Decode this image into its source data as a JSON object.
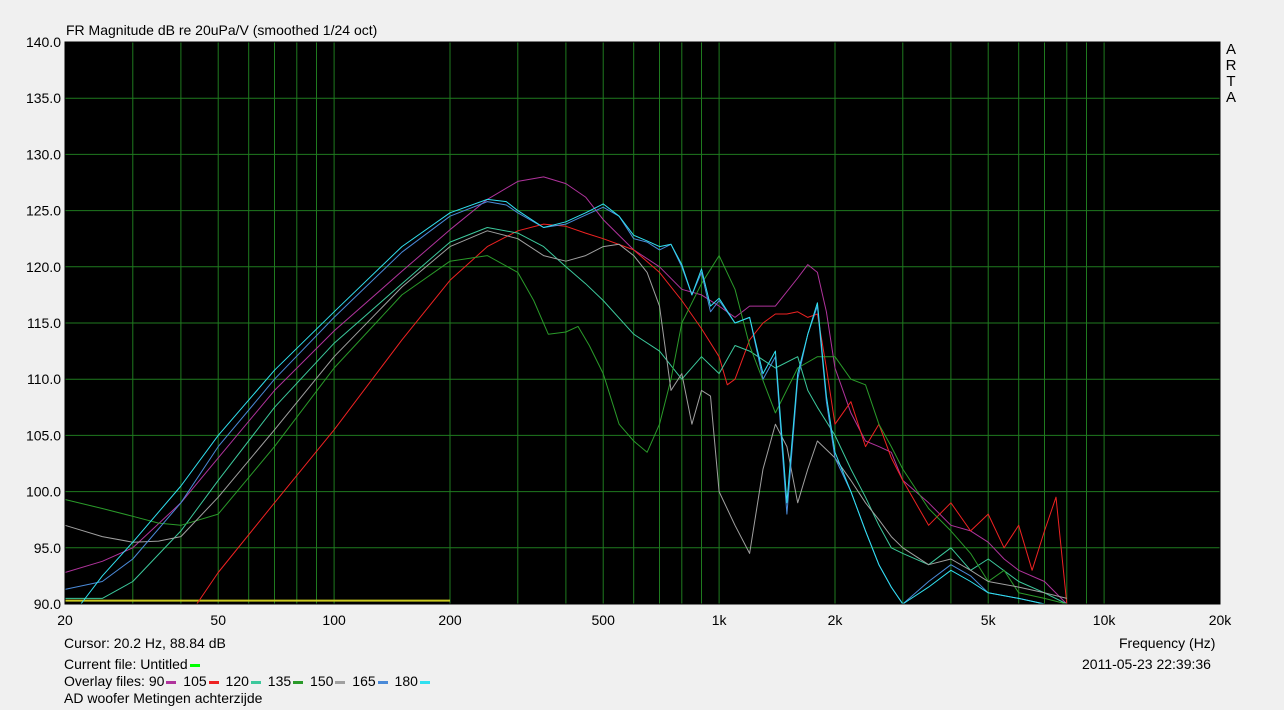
{
  "app": {
    "title": "FR Magnitude dB re 20uPa/V (smoothed 1/24 oct)",
    "watermark": [
      "A",
      "R",
      "T",
      "A"
    ]
  },
  "status": {
    "cursor": "Cursor: 20.2 Hz, 88.84 dB",
    "current_file_label": "Current file: Untitled",
    "current_file_color": "#00ff00",
    "overlay_label": "Overlay files:",
    "overlays": [
      {
        "label": "90",
        "color": "#b0339c"
      },
      {
        "label": "105",
        "color": "#ee2222"
      },
      {
        "label": "120",
        "color": "#3cc89c"
      },
      {
        "label": "135",
        "color": "#2a9a2a"
      },
      {
        "label": "150",
        "color": "#a0a0a0"
      },
      {
        "label": "165",
        "color": "#4a8ad8"
      },
      {
        "label": "180",
        "color": "#30e0f0"
      }
    ],
    "file_name": "AD woofer Metingen achterzijde",
    "x_axis_title": "Frequency (Hz)",
    "timestamp": "2011-05-23  22:39:36"
  },
  "chart_data": {
    "type": "line",
    "title": "FR Magnitude dB re 20uPa/V (smoothed 1/24 oct)",
    "xlabel": "Frequency (Hz)",
    "ylabel": "",
    "x_scale": "log",
    "xlim": [
      20,
      20000
    ],
    "ylim": [
      90,
      140
    ],
    "grid": true,
    "background": "#000000",
    "grid_color": "#1f7a1f",
    "x_ticks": [
      {
        "value": 20,
        "label": "20"
      },
      {
        "value": 50,
        "label": "50"
      },
      {
        "value": 100,
        "label": "100"
      },
      {
        "value": 200,
        "label": "200"
      },
      {
        "value": 500,
        "label": "500"
      },
      {
        "value": 1000,
        "label": "1k"
      },
      {
        "value": 2000,
        "label": "2k"
      },
      {
        "value": 5000,
        "label": "5k"
      },
      {
        "value": 10000,
        "label": "10k"
      },
      {
        "value": 20000,
        "label": "20k"
      }
    ],
    "y_ticks": [
      {
        "value": 90,
        "label": "90.0"
      },
      {
        "value": 95,
        "label": "95.0"
      },
      {
        "value": 100,
        "label": "100.0"
      },
      {
        "value": 105,
        "label": "105.0"
      },
      {
        "value": 110,
        "label": "110.0"
      },
      {
        "value": 115,
        "label": "115.0"
      },
      {
        "value": 120,
        "label": "120.0"
      },
      {
        "value": 125,
        "label": "125.0"
      },
      {
        "value": 130,
        "label": "130.0"
      },
      {
        "value": 135,
        "label": "135.0"
      },
      {
        "value": 140,
        "label": "140.0"
      }
    ],
    "series": [
      {
        "name": "Untitled",
        "color": "#c8c820",
        "x": [
          20,
          200
        ],
        "y": [
          90.3,
          90.3
        ]
      },
      {
        "name": "90",
        "color": "#b0339c",
        "x": [
          20,
          25,
          30,
          40,
          50,
          70,
          100,
          150,
          200,
          250,
          300,
          350,
          400,
          450,
          500,
          600,
          700,
          800,
          900,
          1000,
          1100,
          1200,
          1400,
          1600,
          1700,
          1800,
          1900,
          2000,
          2200,
          2400,
          2600,
          2800,
          3000,
          3500,
          4000,
          4500,
          5000,
          5500,
          6000,
          7000,
          8000
        ],
        "y": [
          92.8,
          93.8,
          95.0,
          99.0,
          103.0,
          109.0,
          114.3,
          119.6,
          123.3,
          126.0,
          127.6,
          128.0,
          127.4,
          126.2,
          124.2,
          121.5,
          120.0,
          118.0,
          117.5,
          116.5,
          115.5,
          116.5,
          116.5,
          119.0,
          120.2,
          119.5,
          116.0,
          111.0,
          107.0,
          104.5,
          104.0,
          103.5,
          101.0,
          99.0,
          97.0,
          96.5,
          95.5,
          94.0,
          93.0,
          92.0,
          90.0
        ]
      },
      {
        "name": "105",
        "color": "#ee2222",
        "x": [
          44,
          50,
          70,
          100,
          150,
          200,
          250,
          300,
          350,
          400,
          450,
          500,
          600,
          700,
          800,
          900,
          1000,
          1050,
          1100,
          1200,
          1300,
          1400,
          1500,
          1600,
          1700,
          1800,
          1900,
          2000,
          2200,
          2400,
          2600,
          2800,
          3000,
          3500,
          4000,
          4500,
          5000,
          5500,
          6000,
          6500,
          7000,
          7500,
          8000
        ],
        "y": [
          90.0,
          92.8,
          99.0,
          105.5,
          113.5,
          118.8,
          121.8,
          123.2,
          123.8,
          123.6,
          123.0,
          122.5,
          121.5,
          119.5,
          117.0,
          114.5,
          112.0,
          109.5,
          110.0,
          113.5,
          115.0,
          115.8,
          115.8,
          116.0,
          115.5,
          115.8,
          111.0,
          106.0,
          108.0,
          104.0,
          106.0,
          103.0,
          101.0,
          97.0,
          99.0,
          96.5,
          98.0,
          95.0,
          97.0,
          93.0,
          96.5,
          99.5,
          90.0
        ]
      },
      {
        "name": "120",
        "color": "#3cc89c",
        "x": [
          20,
          25,
          30,
          40,
          50,
          70,
          100,
          150,
          200,
          250,
          300,
          350,
          400,
          450,
          500,
          600,
          700,
          800,
          900,
          1000,
          1100,
          1200,
          1400,
          1600,
          1700,
          1800,
          2000,
          2200,
          2400,
          2600,
          2800,
          3000,
          3500,
          4000,
          4500,
          5000,
          6000,
          7000,
          8000
        ],
        "y": [
          90.5,
          90.5,
          92.0,
          96.5,
          101.0,
          107.5,
          113.2,
          118.5,
          122.2,
          123.5,
          123.0,
          121.8,
          120.0,
          118.5,
          117.0,
          114.0,
          112.5,
          110.0,
          112.0,
          110.5,
          113.0,
          112.5,
          111.0,
          112.0,
          109.0,
          107.5,
          105.0,
          102.0,
          99.5,
          97.0,
          95.0,
          94.5,
          93.5,
          95.0,
          93.0,
          94.0,
          92.0,
          91.0,
          90.0
        ]
      },
      {
        "name": "135",
        "color": "#2a9a2a",
        "x": [
          20,
          25,
          30,
          35,
          40,
          50,
          70,
          100,
          150,
          200,
          250,
          300,
          330,
          360,
          400,
          430,
          460,
          500,
          550,
          600,
          650,
          700,
          750,
          800,
          900,
          1000,
          1100,
          1200,
          1400,
          1600,
          1800,
          2000,
          2200,
          2400,
          2600,
          2800,
          3000,
          3500,
          4000,
          4500,
          5000,
          5500,
          6000,
          7000,
          8000
        ],
        "y": [
          99.3,
          98.5,
          97.8,
          97.2,
          97.0,
          98.0,
          104.0,
          111.0,
          117.5,
          120.5,
          121.0,
          119.5,
          117.0,
          114.0,
          114.2,
          114.7,
          113.0,
          110.5,
          106.0,
          104.5,
          103.5,
          106.0,
          110.0,
          115.0,
          118.5,
          121.0,
          118.0,
          113.0,
          107.0,
          111.0,
          112.0,
          112.0,
          110.0,
          109.5,
          106.0,
          104.0,
          102.0,
          98.5,
          96.5,
          94.5,
          92.0,
          93.0,
          91.0,
          90.5,
          90.0
        ]
      },
      {
        "name": "150",
        "color": "#a0a0a0",
        "x": [
          20,
          25,
          30,
          35,
          40,
          50,
          70,
          100,
          150,
          200,
          250,
          300,
          350,
          400,
          450,
          500,
          550,
          600,
          650,
          700,
          750,
          800,
          850,
          900,
          950,
          1000,
          1100,
          1200,
          1300,
          1400,
          1500,
          1600,
          1700,
          1800,
          2000,
          2200,
          2400,
          2600,
          2800,
          3000,
          3500,
          4000,
          4500,
          5000,
          6000,
          7000,
          8000
        ],
        "y": [
          97.0,
          96.0,
          95.5,
          95.6,
          96.0,
          99.5,
          105.5,
          112.0,
          118.2,
          121.8,
          123.2,
          122.5,
          121.0,
          120.5,
          121.0,
          121.8,
          122.0,
          121.0,
          119.5,
          116.5,
          109.0,
          110.5,
          106.0,
          109.0,
          108.5,
          100.0,
          97.0,
          94.5,
          102.0,
          106.0,
          104.0,
          99.0,
          102.0,
          104.5,
          103.0,
          101.0,
          99.0,
          97.5,
          96.0,
          95.0,
          93.5,
          94.0,
          93.0,
          92.0,
          91.5,
          91.0,
          90.5
        ]
      },
      {
        "name": "165",
        "color": "#4a8ad8",
        "x": [
          20,
          25,
          30,
          40,
          50,
          70,
          100,
          150,
          200,
          250,
          280,
          300,
          350,
          400,
          450,
          500,
          550,
          600,
          650,
          700,
          750,
          800,
          850,
          900,
          950,
          1000,
          1100,
          1200,
          1300,
          1400,
          1500,
          1600,
          1700,
          1800,
          1900,
          2000,
          2200,
          2400,
          2600,
          2800,
          3000,
          3500,
          4000,
          4500,
          5000,
          6000,
          7000
        ],
        "y": [
          91.3,
          92.0,
          94.0,
          99.0,
          104.0,
          110.0,
          115.5,
          121.3,
          124.5,
          125.8,
          125.5,
          124.8,
          123.5,
          123.8,
          124.6,
          125.3,
          124.5,
          122.5,
          122.2,
          121.5,
          122.0,
          120.0,
          117.5,
          119.5,
          116.0,
          117.0,
          115.0,
          115.5,
          110.0,
          112.0,
          98.0,
          110.0,
          114.0,
          116.5,
          108.0,
          103.0,
          100.0,
          96.5,
          93.5,
          91.5,
          90.0,
          92.0,
          93.5,
          92.5,
          91.0,
          90.5,
          90.0
        ]
      },
      {
        "name": "180",
        "color": "#30e0f0",
        "x": [
          22,
          25,
          30,
          40,
          50,
          70,
          100,
          150,
          200,
          250,
          280,
          300,
          350,
          400,
          450,
          500,
          550,
          600,
          650,
          700,
          750,
          800,
          850,
          900,
          950,
          1000,
          1100,
          1200,
          1300,
          1400,
          1500,
          1600,
          1700,
          1800,
          1900,
          2000,
          2200,
          2400,
          2600,
          2800,
          3000,
          3500,
          4000,
          4500,
          5000,
          6000,
          7000
        ],
        "y": [
          90.0,
          92.5,
          95.5,
          100.5,
          105.0,
          110.8,
          116.0,
          121.8,
          124.8,
          126.0,
          125.8,
          125.0,
          123.5,
          124.0,
          124.8,
          125.6,
          124.5,
          122.8,
          122.3,
          121.8,
          122.0,
          120.2,
          117.5,
          119.8,
          116.5,
          117.2,
          115.0,
          115.5,
          110.5,
          112.5,
          99.0,
          110.5,
          114.0,
          116.8,
          108.5,
          103.5,
          100.0,
          96.5,
          93.5,
          91.5,
          90.0,
          91.5,
          93.0,
          92.0,
          91.0,
          90.5,
          90.0
        ]
      }
    ]
  }
}
